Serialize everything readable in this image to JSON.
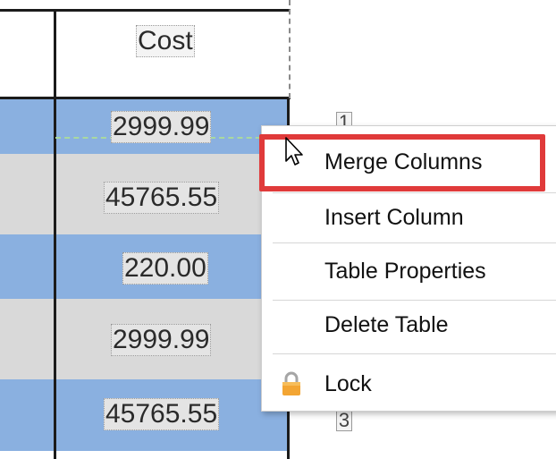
{
  "table": {
    "header": "Cost",
    "rows": [
      "2999.99",
      "45765.55",
      "220.00",
      "2999.99",
      "45765.55"
    ],
    "row_colors": [
      "#8ab0e0",
      "#d9d9d9",
      "#8ab0e0",
      "#d9d9d9",
      "#8ab0e0"
    ],
    "side_labels": [
      "1",
      "3"
    ]
  },
  "context_menu": {
    "items": [
      {
        "label": "Merge Columns",
        "icon": null
      },
      {
        "label": "Insert Column",
        "icon": null
      },
      {
        "label": "Table Properties",
        "icon": null
      },
      {
        "label": "Delete Table",
        "icon": null
      },
      {
        "label": "Lock",
        "icon": "lock-icon"
      }
    ],
    "highlighted_item": "Merge Columns",
    "highlight_color": "#e03a3a"
  }
}
